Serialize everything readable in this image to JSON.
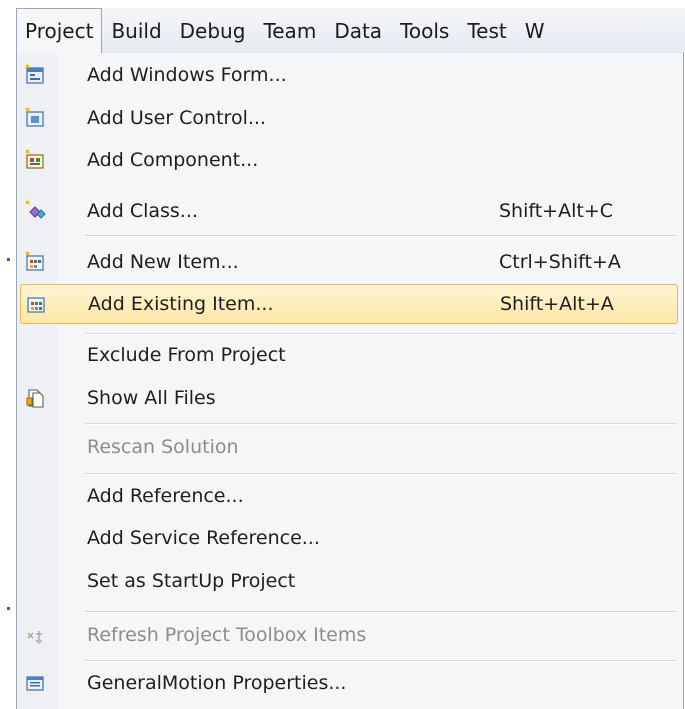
{
  "menubar": {
    "items": [
      {
        "label": "Project",
        "active": true
      },
      {
        "label": "Build"
      },
      {
        "label": "Debug"
      },
      {
        "label": "Team"
      },
      {
        "label": "Data"
      },
      {
        "label": "Tools"
      },
      {
        "label": "Test"
      },
      {
        "label": "W"
      }
    ]
  },
  "menu": {
    "items": [
      {
        "label": "Add Windows Form...",
        "shortcut": "",
        "icon": "windows-form-icon"
      },
      {
        "label": "Add User Control...",
        "shortcut": "",
        "icon": "user-control-icon"
      },
      {
        "label": "Add Component...",
        "shortcut": "",
        "icon": "component-icon"
      },
      {
        "label": "Add Class...",
        "shortcut": "Shift+Alt+C",
        "icon": "class-icon"
      },
      {
        "label": "Add New Item...",
        "shortcut": "Ctrl+Shift+A",
        "icon": "new-item-icon"
      },
      {
        "label": "Add Existing Item...",
        "shortcut": "Shift+Alt+A",
        "icon": "existing-item-icon",
        "highlighted": true
      },
      {
        "label": "Exclude From Project",
        "shortcut": ""
      },
      {
        "label": "Show All Files",
        "shortcut": "",
        "icon": "show-all-files-icon"
      },
      {
        "label": "Rescan Solution",
        "shortcut": "",
        "disabled": true
      },
      {
        "label": "Add Reference...",
        "shortcut": ""
      },
      {
        "label": "Add Service Reference...",
        "shortcut": ""
      },
      {
        "label": "Set as StartUp Project",
        "shortcut": ""
      },
      {
        "label": "Refresh Project Toolbox Items",
        "shortcut": "",
        "icon": "refresh-toolbox-icon",
        "disabled": true
      },
      {
        "label": "GeneralMotion Properties...",
        "shortcut": "",
        "icon": "properties-icon"
      }
    ]
  },
  "colors": {
    "highlight_fill": "#fde7a8",
    "highlight_border": "#e6b84a",
    "menu_background": "#f5f6f8",
    "disabled_text": "#8c8c8c"
  }
}
